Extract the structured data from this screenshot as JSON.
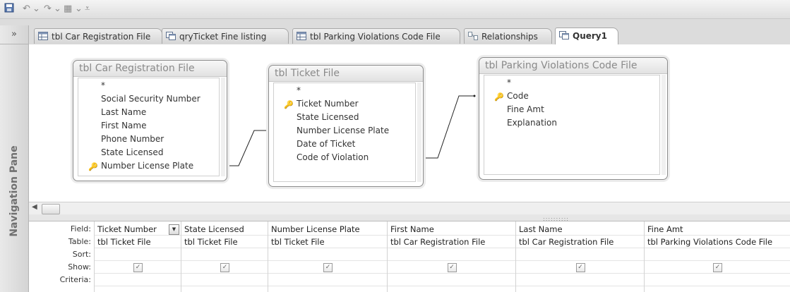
{
  "qat": {
    "save": "save-icon",
    "undo": "undo-icon",
    "redo": "redo-icon",
    "view": "view-icon",
    "customize": "customize-qat-icon"
  },
  "nav": {
    "toggle": "»",
    "label": "Navigation Pane"
  },
  "tabs": [
    {
      "label": "tbl Car Registration File",
      "icon": "table-icon"
    },
    {
      "label": "qryTicket Fine listing",
      "icon": "query-icon"
    },
    {
      "label": "tbl Parking Violations Code File",
      "icon": "table-icon"
    },
    {
      "label": "Relationships",
      "icon": "relationships-icon"
    },
    {
      "label": "Query1",
      "icon": "query-icon",
      "active": true
    }
  ],
  "tables": [
    {
      "title": "tbl Car Registration File",
      "fields": [
        {
          "name": "*",
          "key": false
        },
        {
          "name": "Social Security Number",
          "key": false
        },
        {
          "name": "Last Name",
          "key": false
        },
        {
          "name": "First Name",
          "key": false
        },
        {
          "name": "Phone Number",
          "key": false
        },
        {
          "name": "State Licensed",
          "key": false
        },
        {
          "name": "Number License Plate",
          "key": true
        }
      ]
    },
    {
      "title": "tbl Ticket File",
      "fields": [
        {
          "name": "*",
          "key": false
        },
        {
          "name": "Ticket Number",
          "key": true
        },
        {
          "name": "State Licensed",
          "key": false
        },
        {
          "name": "Number License Plate",
          "key": false
        },
        {
          "name": "Date of Ticket",
          "key": false
        },
        {
          "name": "Code of Violation",
          "key": false
        }
      ]
    },
    {
      "title": "tbl Parking Violations Code File",
      "fields": [
        {
          "name": "*",
          "key": false
        },
        {
          "name": "Code",
          "key": true
        },
        {
          "name": "Fine Amt",
          "key": false
        },
        {
          "name": "Explanation",
          "key": false
        }
      ]
    }
  ],
  "grid": {
    "row_labels": [
      "Field:",
      "Table:",
      "Sort:",
      "Show:",
      "Criteria:"
    ],
    "columns": [
      {
        "field": "Ticket Number",
        "table": "tbl Ticket File",
        "sort": "",
        "show": true
      },
      {
        "field": "State Licensed",
        "table": "tbl Ticket File",
        "sort": "",
        "show": true
      },
      {
        "field": "Number License Plate",
        "table": "tbl Ticket File",
        "sort": "",
        "show": true
      },
      {
        "field": "First Name",
        "table": "tbl Car Registration File",
        "sort": "",
        "show": true
      },
      {
        "field": "Last Name",
        "table": "tbl Car Registration File",
        "sort": "",
        "show": true
      },
      {
        "field": "Fine Amt",
        "table": "tbl Parking Violations Code File",
        "sort": "",
        "show": true
      }
    ]
  },
  "check_glyph": "✓",
  "dropdown_glyph": "▼",
  "scroll": {
    "left": "◀"
  }
}
